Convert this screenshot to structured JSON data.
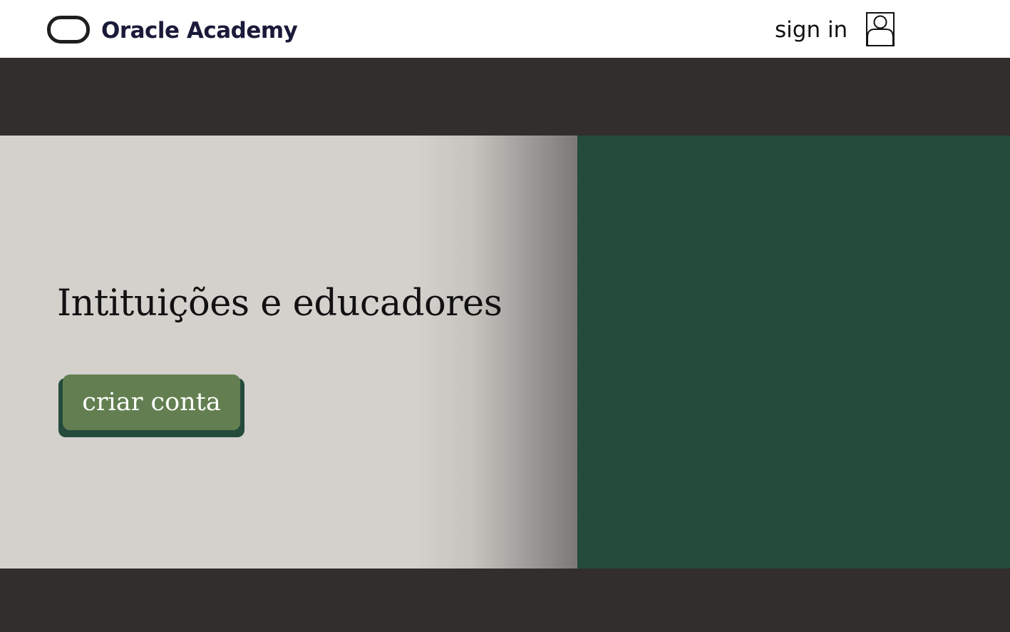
{
  "header": {
    "brand": "Oracle Academy",
    "signin_label": "sign in"
  },
  "hero": {
    "title": "Intituições e educadores",
    "cta_label": "criar conta"
  },
  "colors": {
    "dark_band": "#322e2c",
    "hero_panel_green": "#244b3c",
    "cta_green": "#637f51",
    "hero_left_bg": "#d4d1cd"
  },
  "icons": {
    "logo": "oracle-capsule-logo",
    "user": "user-icon"
  }
}
